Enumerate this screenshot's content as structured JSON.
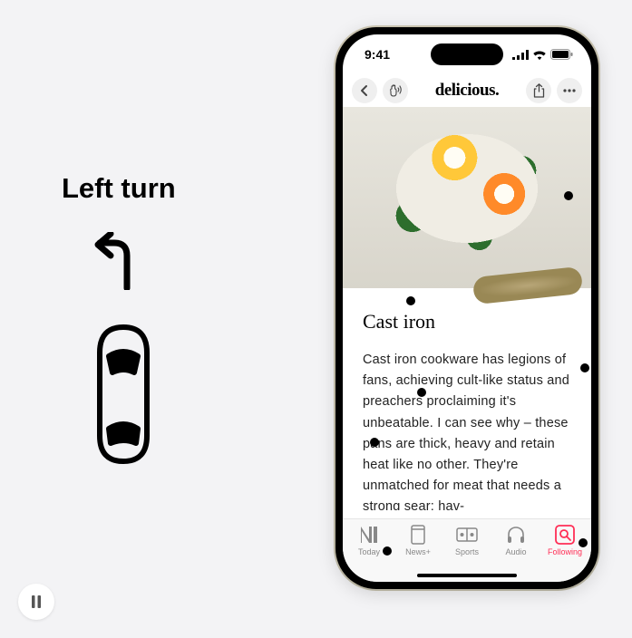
{
  "left": {
    "label": "Left turn"
  },
  "status": {
    "time": "9:41"
  },
  "nav": {
    "title": "delicious."
  },
  "article": {
    "title": "Cast iron",
    "body": "Cast iron cookware has legions of fans, achieving cult-like status and preachers proclaiming it's unbeatable. I can see why – these pans are thick, heavy and retain heat like no other. They're unmatched for meat that needs a strong sear; hav-"
  },
  "tabs": [
    {
      "label": "Today"
    },
    {
      "label": "News+"
    },
    {
      "label": "Sports"
    },
    {
      "label": "Audio"
    },
    {
      "label": "Following"
    }
  ]
}
